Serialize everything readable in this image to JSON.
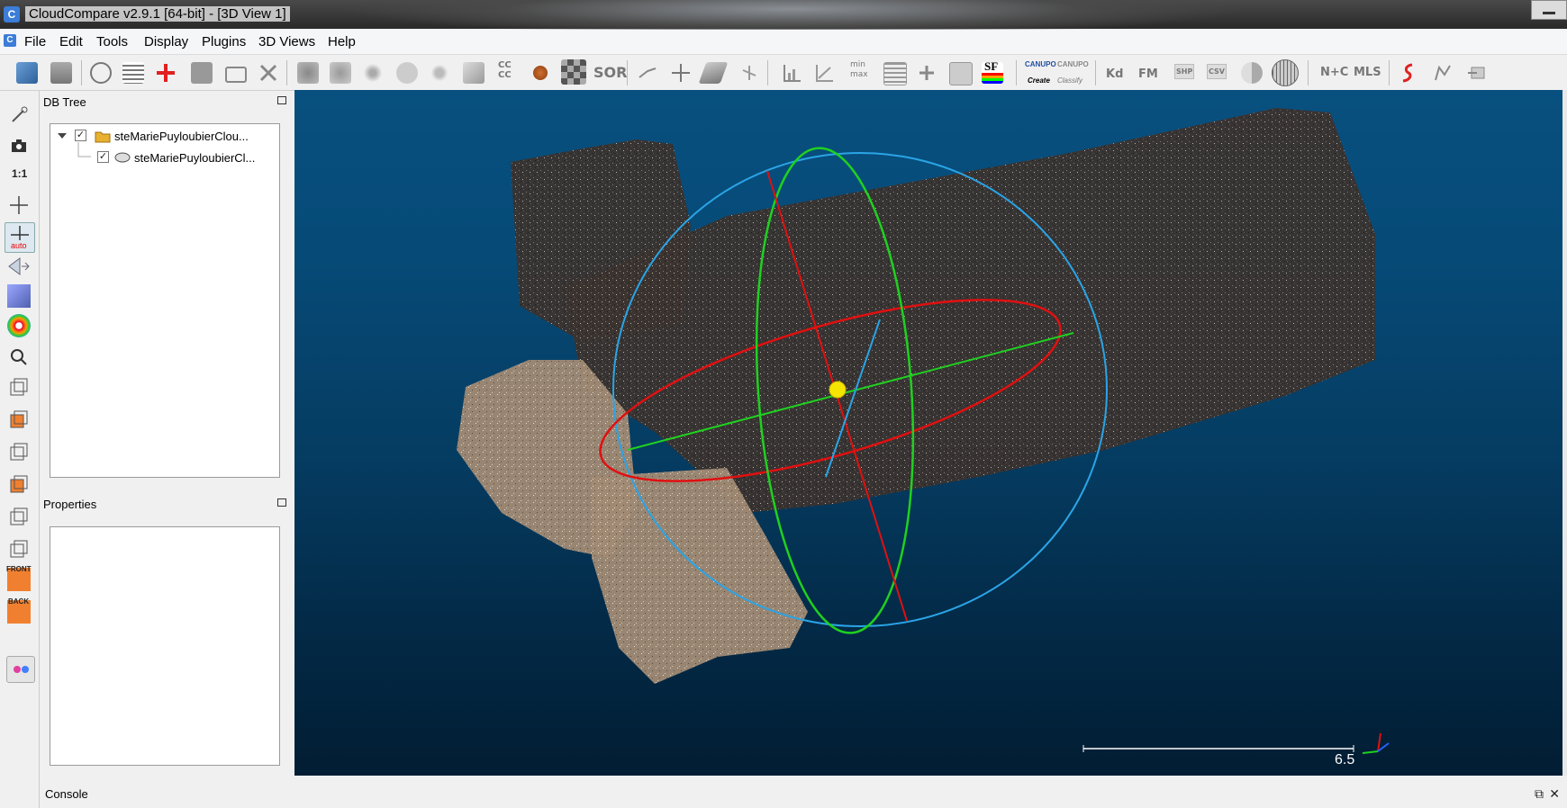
{
  "window": {
    "title": "CloudCompare v2.9.1 [64-bit] - [3D View 1]",
    "app_icon_letter": "C"
  },
  "menu": {
    "items": [
      "File",
      "Edit",
      "Tools",
      "Display",
      "Plugins",
      "3D Views",
      "Help"
    ]
  },
  "toolbar": {
    "ccc_label": "CC\nCC",
    "sor_label": "SOR",
    "minmax_label": "min\nmax",
    "sf_label": "SF",
    "canupo_create": "CANUPO",
    "canupo_create_sub": "Create",
    "canupo_classify": "CANUPO",
    "canupo_classify_sub": "Classify",
    "kd_label": "Kd",
    "fm_label": "FM",
    "shp_label": "SHP",
    "csv_label": "CSV",
    "nc_label": "N+C",
    "mls_label": "MLS"
  },
  "left_tools": {
    "one_to_one": "1:1",
    "auto": "auto",
    "front": "FRONT",
    "back": "BACK"
  },
  "db_tree": {
    "title": "DB Tree",
    "items": [
      {
        "label": "steMariePuyloubierClou...",
        "checked": true
      },
      {
        "label": "steMariePuyloubierCl...",
        "checked": true
      }
    ]
  },
  "properties": {
    "title": "Properties"
  },
  "view": {
    "scale_value": "6.5"
  },
  "console": {
    "title": "Console"
  },
  "colors": {
    "view_bg_top": "#08507f",
    "view_bg_bottom": "#021d33",
    "axis_red": "#e01010",
    "axis_green": "#20d020",
    "axis_blue": "#2aa4e6",
    "pivot_yellow": "#f4e400"
  }
}
